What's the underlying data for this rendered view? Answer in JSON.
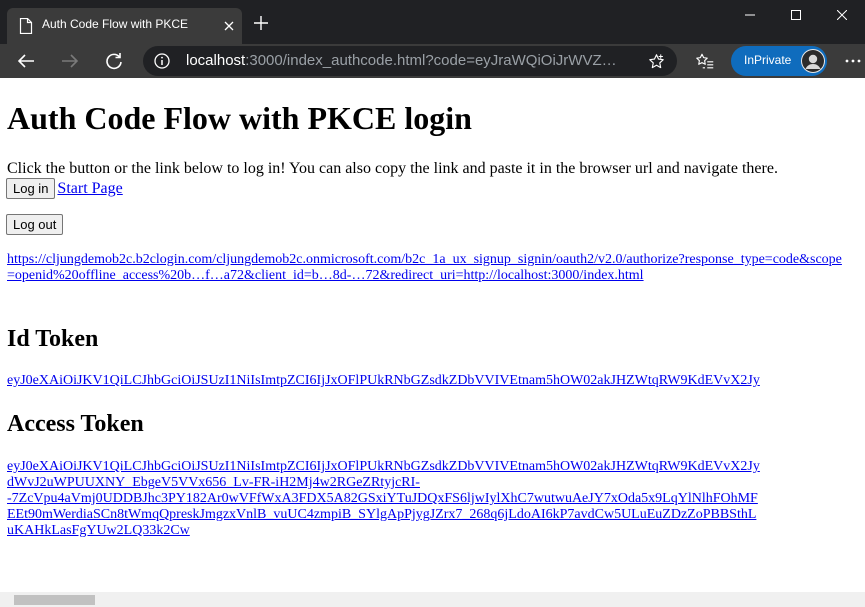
{
  "browser": {
    "tab_title": "Auth Code Flow with PKCE",
    "address_host": "localhost",
    "address_rest": ":3000/index_authcode.html?code=eyJraWQiOiJrWVZ…",
    "inprivate_label": "InPrivate",
    "icons": [
      "page-icon",
      "close-icon",
      "plus-icon",
      "minimize-icon",
      "maximize-icon",
      "close-icon",
      "back-arrow-icon",
      "forward-arrow-icon",
      "refresh-icon",
      "info-icon",
      "star-icon",
      "favorites-icon",
      "avatar",
      "more-icon"
    ]
  },
  "page": {
    "title": "Auth Code Flow with PKCE login",
    "intro": "Click the button or the link below to log in! You can also copy the link and paste it in the browser url and navigate there.",
    "login_button": "Log in",
    "start_page_link": "Start Page",
    "logout_button": "Log out",
    "auth_url": "https://cljungdemob2c.b2clogin.com/cljungdemob2c.onmicrosoft.com/b2c_1a_ux_signup_signin/oauth2/v2.0/authorize?response_type=code&scope=openid%20offline_access%20b…f…a72&client_id=b…8d-…72&redirect_uri=http://localhost:3000/index.html",
    "id_token_heading": "Id Token",
    "id_token": "eyJ0eXAiOiJKV1QiLCJhbGciOiJSUzI1NiIsImtpZCI6IjJxOFlPUkRNbGZsdkZDbVVIVEtnam5hOW02akJHZWtqRW9KdEVvX2Jy",
    "access_token_heading": "Access Token",
    "access_token": "eyJ0eXAiOiJKV1QiLCJhbGciOiJSUzI1NiIsImtpZCI6IjJxOFlPUkRNbGZsdkZDbVVIVEtnam5hOW02akJHZWtqRW9KdEVvX2Jy\ndWvJ2uWPUUXNY_EbgeV5VVx656_Lv-FR-iH2Mj4w2RGeZRtyjcRI-\n-7ZcVpu4aVmj0UDDBJhc3PY182Ar0wVFfWxA3FDX5A82GSxiYTuJDQxFS6ljwIylXhC7wutwuAeJY7xOda5x9LqYlNlhFOhMF\nEEt90mWerdiaSCn8tWmqQpreskJmgzxVnlB_vuUC4zmpiB_SYlgApPjygJZrx7_268q6jLdoAI6kP7avdCw5ULuEuZDzZoPBBSthL\nuKAHkLasFgYUw2LQ33k2Cw"
  }
}
